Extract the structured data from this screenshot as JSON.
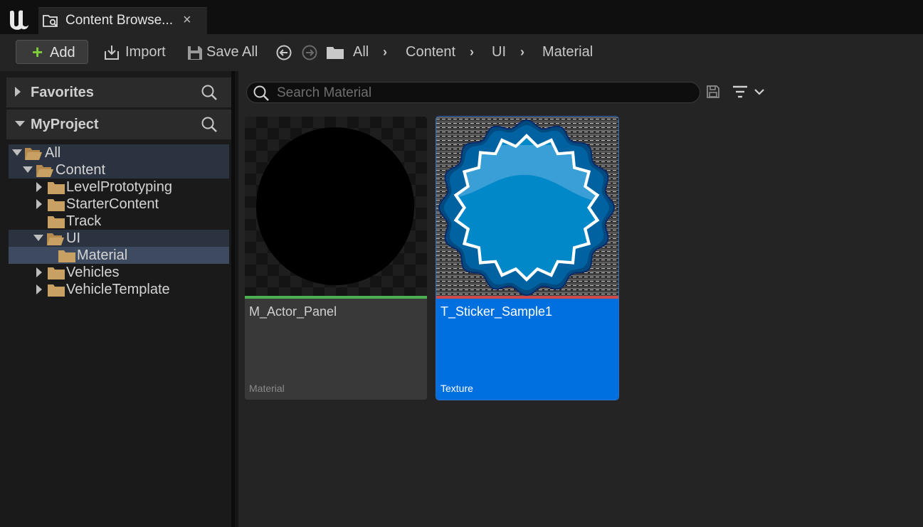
{
  "window": {
    "tab_title": "Content Browse...",
    "tab_icon": "content-browser-icon",
    "close_glyph": "×"
  },
  "toolbar": {
    "add_label": "Add",
    "import_label": "Import",
    "save_all_label": "Save All"
  },
  "breadcrumb": [
    "All",
    "Content",
    "UI",
    "Material"
  ],
  "sidebar": {
    "favorites_label": "Favorites",
    "project_label": "MyProject",
    "tree": [
      {
        "label": "All",
        "depth": 0,
        "expanded": true
      },
      {
        "label": "Content",
        "depth": 1,
        "expanded": true
      },
      {
        "label": "LevelPrototyping",
        "depth": 2,
        "expanded": false
      },
      {
        "label": "StarterContent",
        "depth": 2,
        "expanded": false
      },
      {
        "label": "Track",
        "depth": 2,
        "expanded": null
      },
      {
        "label": "UI",
        "depth": 2,
        "expanded": true
      },
      {
        "label": "Material",
        "depth": 3,
        "selected": true
      },
      {
        "label": "Vehicles",
        "depth": 2,
        "expanded": false
      },
      {
        "label": "VehicleTemplate",
        "depth": 2,
        "expanded": false
      }
    ]
  },
  "search": {
    "placeholder": "Search Material"
  },
  "assets": [
    {
      "name": "M_Actor_Panel",
      "type": "Material",
      "accent": "#4caf50",
      "selected": false
    },
    {
      "name": "T_Sticker_Sample1",
      "type": "Texture",
      "accent": "#d04a4a",
      "selected": true
    }
  ],
  "colors": {
    "selection_blue": "#0070e0",
    "folder": "#c9a063",
    "add_plus": "#7fcf3a"
  }
}
